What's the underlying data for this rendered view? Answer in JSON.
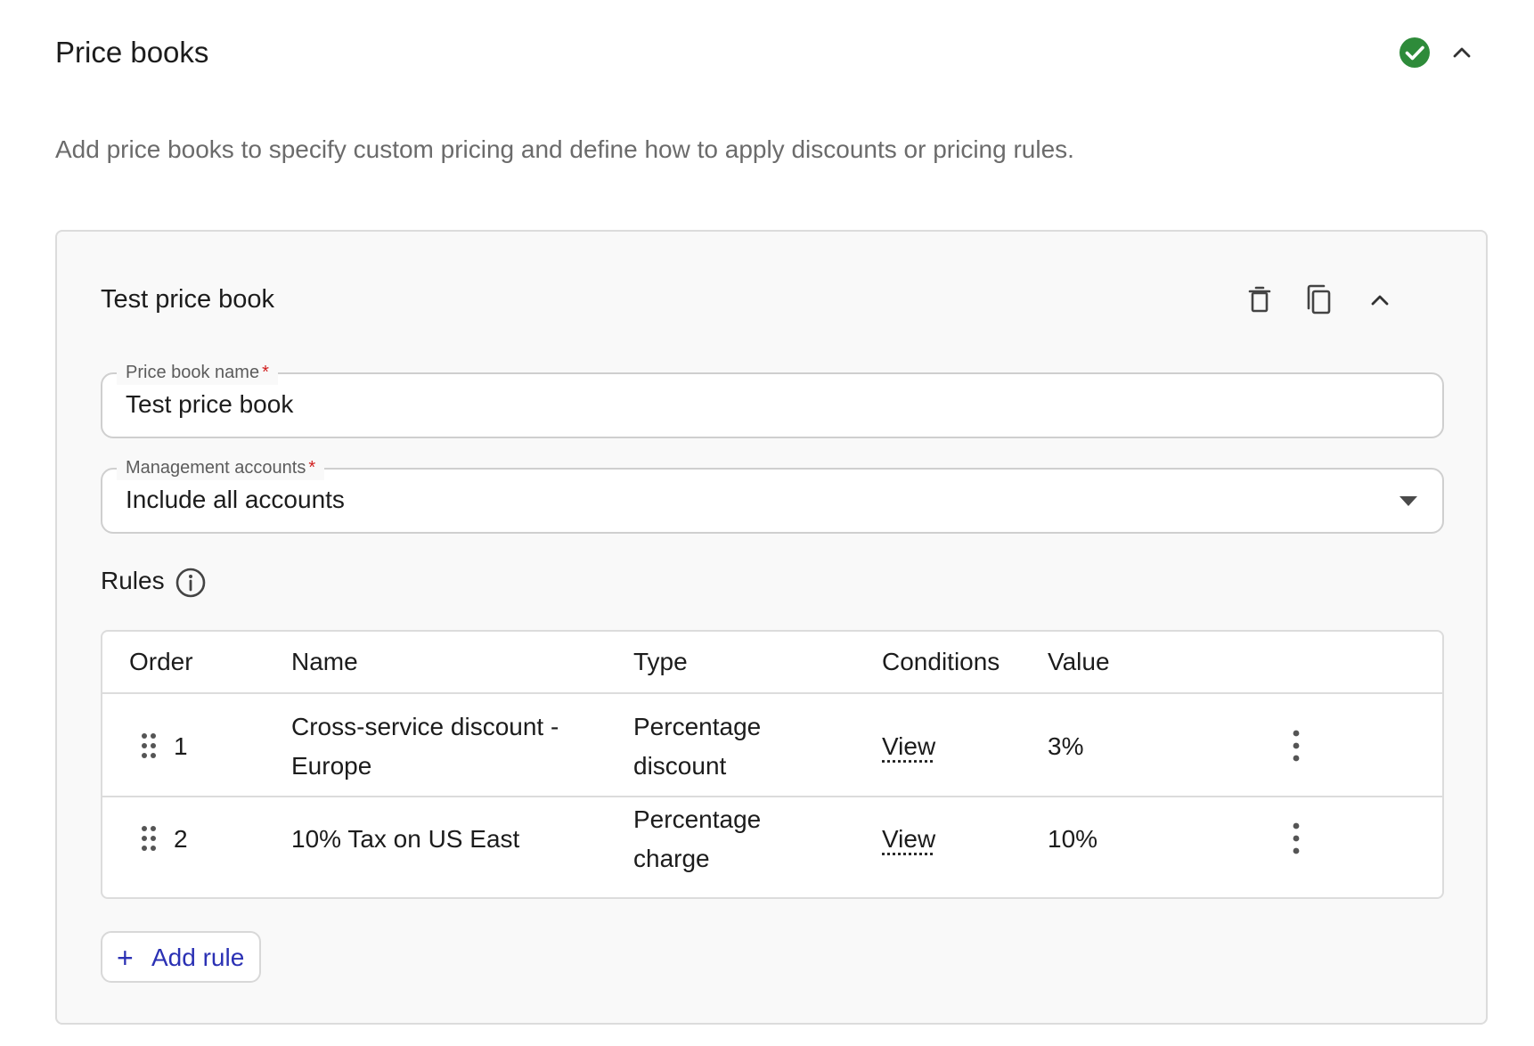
{
  "section": {
    "title": "Price books",
    "description": "Add price books to specify custom pricing and define how to apply discounts or pricing rules.",
    "status_color": "#2e8b3a"
  },
  "price_book": {
    "title": "Test price book",
    "fields": {
      "name": {
        "label": "Price book name",
        "required_mark": "*",
        "value": "Test price book"
      },
      "accounts": {
        "label": "Management accounts",
        "required_mark": "*",
        "value": "Include all accounts"
      }
    },
    "rules": {
      "heading": "Rules",
      "columns": [
        "Order",
        "Name",
        "Type",
        "Conditions",
        "Value"
      ],
      "rows": [
        {
          "order": "1",
          "name": "Cross-service discount - Europe",
          "type": "Percentage discount",
          "conditions": "View",
          "value": "3%"
        },
        {
          "order": "2",
          "name": "10% Tax on US East",
          "type": "Percentage charge",
          "conditions": "View",
          "value": "10%"
        }
      ]
    },
    "add_rule": {
      "icon": "+",
      "label": "Add rule"
    }
  },
  "colors": {
    "accent": "#2b31b4",
    "required": "#d11e1e",
    "success": "#2e8b3a"
  }
}
